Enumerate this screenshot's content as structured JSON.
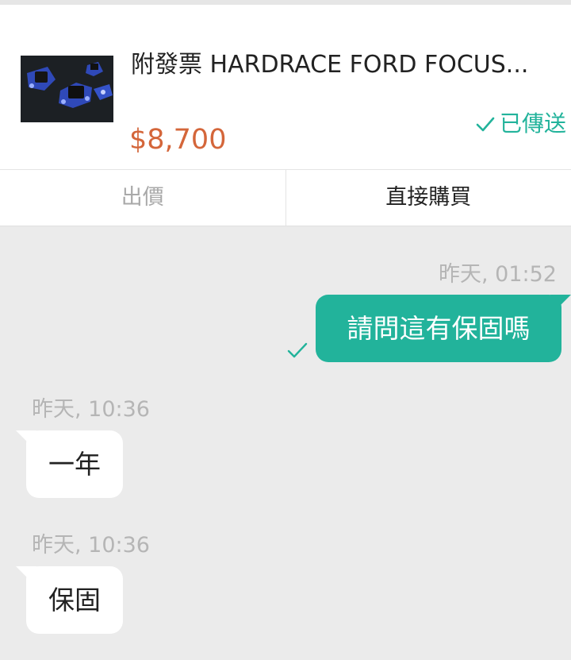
{
  "product": {
    "title": "附發票 HARDRACE FORD FOCUS...",
    "price": "$8,700",
    "status_label": "已傳送",
    "status_icon": "check-icon",
    "thumbnail_icon": "engine-mount-product-image"
  },
  "actions": {
    "offer_label": "出價",
    "buy_label": "直接購買"
  },
  "messages": [
    {
      "direction": "outgoing",
      "time": "昨天, 01:52",
      "text": "請問這有保固嗎",
      "read_icon": "check-icon"
    },
    {
      "direction": "incoming",
      "time": "昨天, 10:36",
      "text": "一年"
    },
    {
      "direction": "incoming",
      "time": "昨天, 10:36",
      "text": "保固"
    }
  ],
  "colors": {
    "accent": "#22b39b",
    "price": "#d4663a",
    "chat_background": "#ebebeb"
  }
}
